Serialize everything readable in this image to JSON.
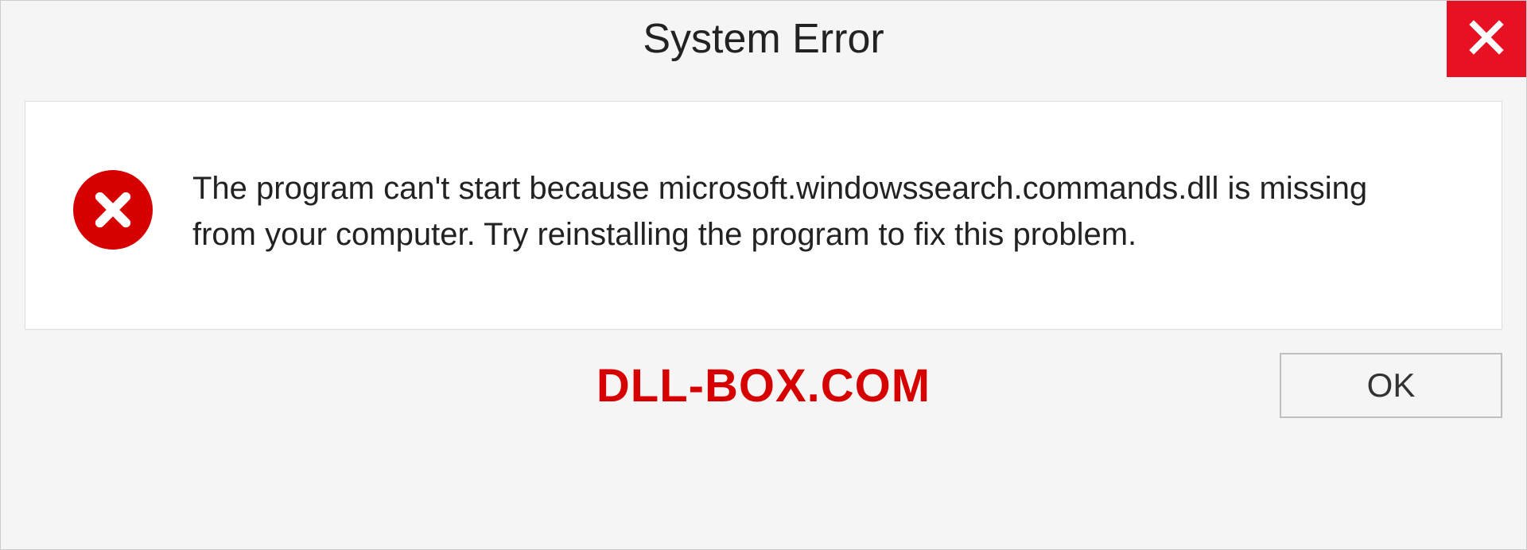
{
  "titlebar": {
    "title": "System Error"
  },
  "content": {
    "message": "The program can't start because microsoft.windowssearch.commands.dll is missing from your computer. Try reinstalling the program to fix this problem."
  },
  "footer": {
    "watermark": "DLL-BOX.COM",
    "ok_label": "OK"
  },
  "colors": {
    "close_bg": "#e81123",
    "error_icon_bg": "#d60000",
    "watermark_color": "#d60000"
  }
}
